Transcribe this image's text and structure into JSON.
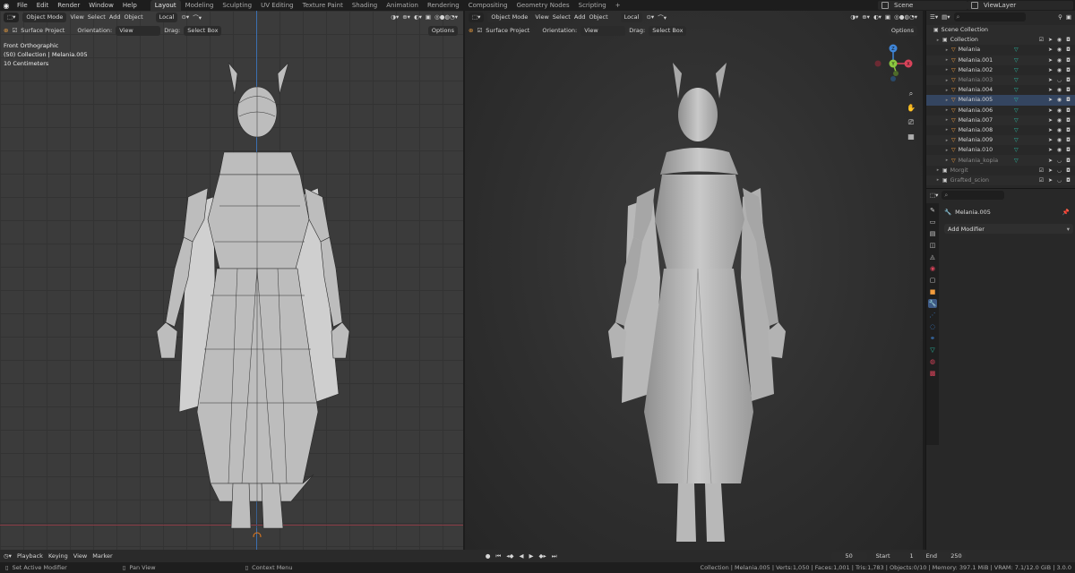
{
  "menu": [
    "File",
    "Edit",
    "Render",
    "Window",
    "Help"
  ],
  "workspaces": [
    "Layout",
    "Modeling",
    "Sculpting",
    "UV Editing",
    "Texture Paint",
    "Shading",
    "Animation",
    "Rendering",
    "Compositing",
    "Geometry Nodes",
    "Scripting"
  ],
  "active_workspace": "Layout",
  "scene": "Scene",
  "view_layer": "ViewLayer",
  "viewport_left": {
    "mode": "Object Mode",
    "menus": [
      "View",
      "Select",
      "Add",
      "Object"
    ],
    "transform": "Local",
    "snap_label": "Surface Project",
    "orientation_label": "Orientation:",
    "orientation_value": "View",
    "drag_label": "Drag:",
    "drag_value": "Select Box",
    "options": "Options",
    "overlay_line1": "Front Orthographic",
    "overlay_line2": "(50) Collection | Melania.005",
    "overlay_line3": "10 Centimeters"
  },
  "viewport_right": {
    "mode": "Object Mode",
    "menus": [
      "View",
      "Select",
      "Add",
      "Object"
    ],
    "transform": "Local",
    "snap_label": "Surface Project",
    "orientation_label": "Orientation:",
    "orientation_value": "View",
    "drag_label": "Drag:",
    "drag_value": "Select Box",
    "options": "Options",
    "gizmo": {
      "z": "Z",
      "y": "Y",
      "x": "X"
    }
  },
  "outliner": {
    "root": "Scene Collection",
    "items": [
      {
        "label": "Collection",
        "kind": "collection"
      },
      {
        "label": "Melania",
        "kind": "mesh"
      },
      {
        "label": "Melania.001",
        "kind": "mesh"
      },
      {
        "label": "Melania.002",
        "kind": "mesh"
      },
      {
        "label": "Melania.003",
        "kind": "mesh",
        "dim": true
      },
      {
        "label": "Melania.004",
        "kind": "mesh"
      },
      {
        "label": "Melania.005",
        "kind": "mesh",
        "selected": true
      },
      {
        "label": "Melania.006",
        "kind": "mesh"
      },
      {
        "label": "Melania.007",
        "kind": "mesh"
      },
      {
        "label": "Melania.008",
        "kind": "mesh"
      },
      {
        "label": "Melania.009",
        "kind": "mesh"
      },
      {
        "label": "Melania.010",
        "kind": "mesh"
      },
      {
        "label": "Melania_kopia",
        "kind": "mesh",
        "dim": true
      },
      {
        "label": "Morgit",
        "kind": "collection",
        "dim": true
      },
      {
        "label": "Grafted_scion",
        "kind": "collection",
        "dim": true
      }
    ]
  },
  "properties": {
    "object_name": "Melania.005",
    "add_modifier": "Add Modifier"
  },
  "timeline": {
    "menus": [
      "Playback",
      "Keying",
      "View",
      "Marker"
    ],
    "current_frame": "50",
    "start_label": "Start",
    "start_value": "1",
    "end_label": "End",
    "end_value": "250"
  },
  "statusbar": {
    "left": "Set Active Modifier",
    "middle": "Pan View",
    "right_hint": "Context Menu",
    "stats": "Collection | Melania.005 | Verts:1,050 | Faces:1,001 | Tris:1,783 | Objects:0/10 | Memory: 397.1 MiB | VRAM: 7.1/12.0 GiB | 3.0.0"
  },
  "colors": {
    "accent": "#4772b3",
    "mesh_icon": "#f39c3c",
    "modifier_icon": "#28c0a6",
    "axis_x": "#d9435a",
    "axis_y": "#8bc63f",
    "axis_z": "#3f86d9"
  }
}
